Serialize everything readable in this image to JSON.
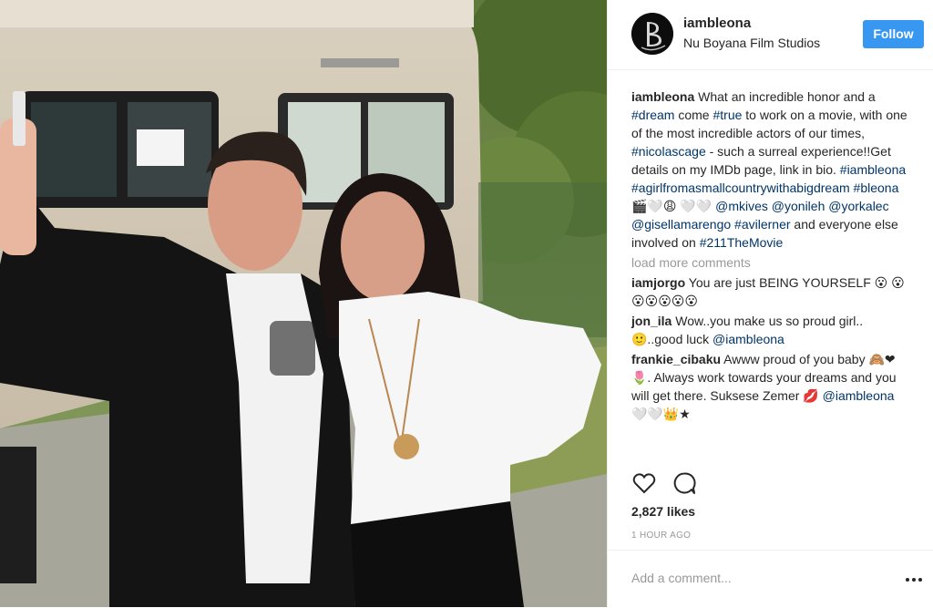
{
  "post": {
    "username": "iambleona",
    "location": "Nu Boyana Film Studios",
    "follow_label": "Follow"
  },
  "caption": {
    "user": "iambleona",
    "p1": " What an incredible honor and a ",
    "t1": "#dream",
    "p2": " come ",
    "t2": "#true",
    "p3": " to work on a movie, with one of the most incredible actors of our times, ",
    "t3": "#nicolascage",
    "p4": " - such a surreal experience!!Get details on my IMDb page, link in bio. ",
    "t4": "#iambleona",
    "t5": "#agirlfromasmallcountrywithabigdream",
    "t6": "#bleona",
    "p5": " 🎬🤍😩 🤍🤍 ",
    "t7": "@mkives",
    "t8": "@yonileh",
    "t9": "@yorkalec",
    "t10": "@gisellamarengo",
    "t11": "#avilerner",
    "p6": " and everyone else involved on ",
    "t12": "#211TheMovie"
  },
  "load_more": "load more comments",
  "comments": [
    {
      "user": "iamjorgo",
      "text": " You are just BEING YOURSELF 😮 😮😮😮😮😮😮"
    },
    {
      "user": "jon_ila",
      "text": " Wow..you make us so proud girl.. 🙂..good luck ",
      "mention": "@iambleona"
    },
    {
      "user": "frankie_cibaku",
      "text": " Awww proud of you baby 🙈❤🌷. Always work towards your dreams and you will get there. Suksese Zemer 💋 ",
      "mention": "@iambleona",
      "tail": " 🤍🤍👑★"
    }
  ],
  "actions": {
    "like_icon": "heart-outline-icon",
    "comment_icon": "comment-bubble-icon"
  },
  "likes": "2,827 likes",
  "time": "1 HOUR AGO",
  "add_comment": {
    "placeholder": "Add a comment..."
  },
  "colors": {
    "follow": "#3897f0",
    "tag": "#003569",
    "muted": "#999999",
    "text": "#262626"
  }
}
